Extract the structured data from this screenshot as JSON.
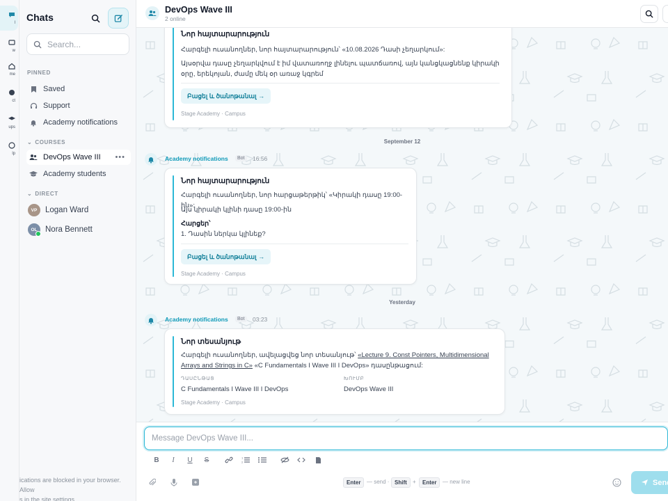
{
  "rail": {
    "items": [
      {
        "label": "l",
        "icon": "chat-bubbles-icon"
      },
      {
        "label": "w",
        "icon": "news-icon"
      },
      {
        "label": "me",
        "icon": "home-icon"
      },
      {
        "label": "ct",
        "icon": "contact-icon"
      },
      {
        "label": "ups",
        "icon": "groups-icon"
      },
      {
        "label": "lp",
        "icon": "help-icon"
      }
    ]
  },
  "sidebar": {
    "title": "Chats",
    "search_placeholder": "Search...",
    "pinned_label": "PINNED",
    "pinned": [
      {
        "label": "Saved",
        "icon": "bookmark-icon"
      },
      {
        "label": "Support",
        "icon": "headset-icon"
      },
      {
        "label": "Academy notifications",
        "icon": "bell-icon"
      }
    ],
    "courses_label": "COURSES",
    "courses": [
      {
        "label": "DevOps Wave III",
        "icon": "users-icon"
      },
      {
        "label": "Academy students",
        "icon": "graduation-cap-icon"
      }
    ],
    "direct_label": "DIRECT",
    "direct": [
      {
        "name": "Logan Ward",
        "initials": "VP",
        "color": "#a89588"
      },
      {
        "name": "Nora Bennett",
        "initials": "OL",
        "color": "#7c8fa8"
      }
    ],
    "notice_line1": "ications are blocked in your browser. Allow",
    "notice_line2": "s in the site settings."
  },
  "header": {
    "title": "DevOps Wave III",
    "subtitle": "2 online"
  },
  "feed": {
    "messages": [
      {
        "title": "Նոր հայտարարություն",
        "line1": "Հարգելի ուսանողներ, նոր հայտարարություն՝ «10.08.2026 Դասի չեղարկում»:",
        "line2": "Այսօրվա դասը չեղարկվում է իմ վատառողջ լինելու պատճառով, այն կանցկացնենք կիրակի",
        "line3": "օրը, երեկոյան, ժամը մեկ օր առաջ կգրեմ",
        "button": "Բացել և ծանոթանալ →",
        "footer": "Stage Academy · Campus"
      },
      {
        "date": "September 12",
        "sender": "Academy notifications",
        "badge": "Bot",
        "time": "16:56",
        "title": "Նոր հայտարարություն",
        "line1": "Հարգելի ուսանողներ, նոր հարցաթերթիկ՝ «Կիրակի դասը 19:00-ին»:",
        "line2": "Այս կիրակի կլինի դասը 19:00-ին",
        "question_label": "Հարցեր՝",
        "question": "1. Դասին ներկա կլինեք?",
        "button": "Բացել և ծանոթանալ →",
        "footer": "Stage Academy · Campus"
      },
      {
        "date": "Yesterday",
        "sender": "Academy notifications",
        "badge": "Bot",
        "time": "03:23",
        "title": "Նոր տեսանյութ",
        "intro": "Հարգելի ուսանողներ, ավելացվեց նոր տեսանյութ՝ ",
        "link_part1": "«Lecture 9. Const Pointers, Multidimensional",
        "link_part2": "Arrays and Strings in C»",
        "outro": " «C Fundamentals I Wave III I DevOps» դասընթացում:",
        "course_label": "ԴԱՍԸՆԹԱՑ",
        "course_value": "C Fundamentals I Wave III I DevOps",
        "group_label": "ԽՈՒՄԲ",
        "group_value": "DevOps Wave III",
        "footer": "Stage Academy · Campus"
      }
    ]
  },
  "composer": {
    "placeholder": "Message DevOps Wave III...",
    "kbd_enter": "Enter",
    "send_hint": "— send ·",
    "kbd_shift": "Shift",
    "plus": "+",
    "kbd_enter2": "Enter",
    "newline_hint": "— new line",
    "send_label": "Send"
  }
}
